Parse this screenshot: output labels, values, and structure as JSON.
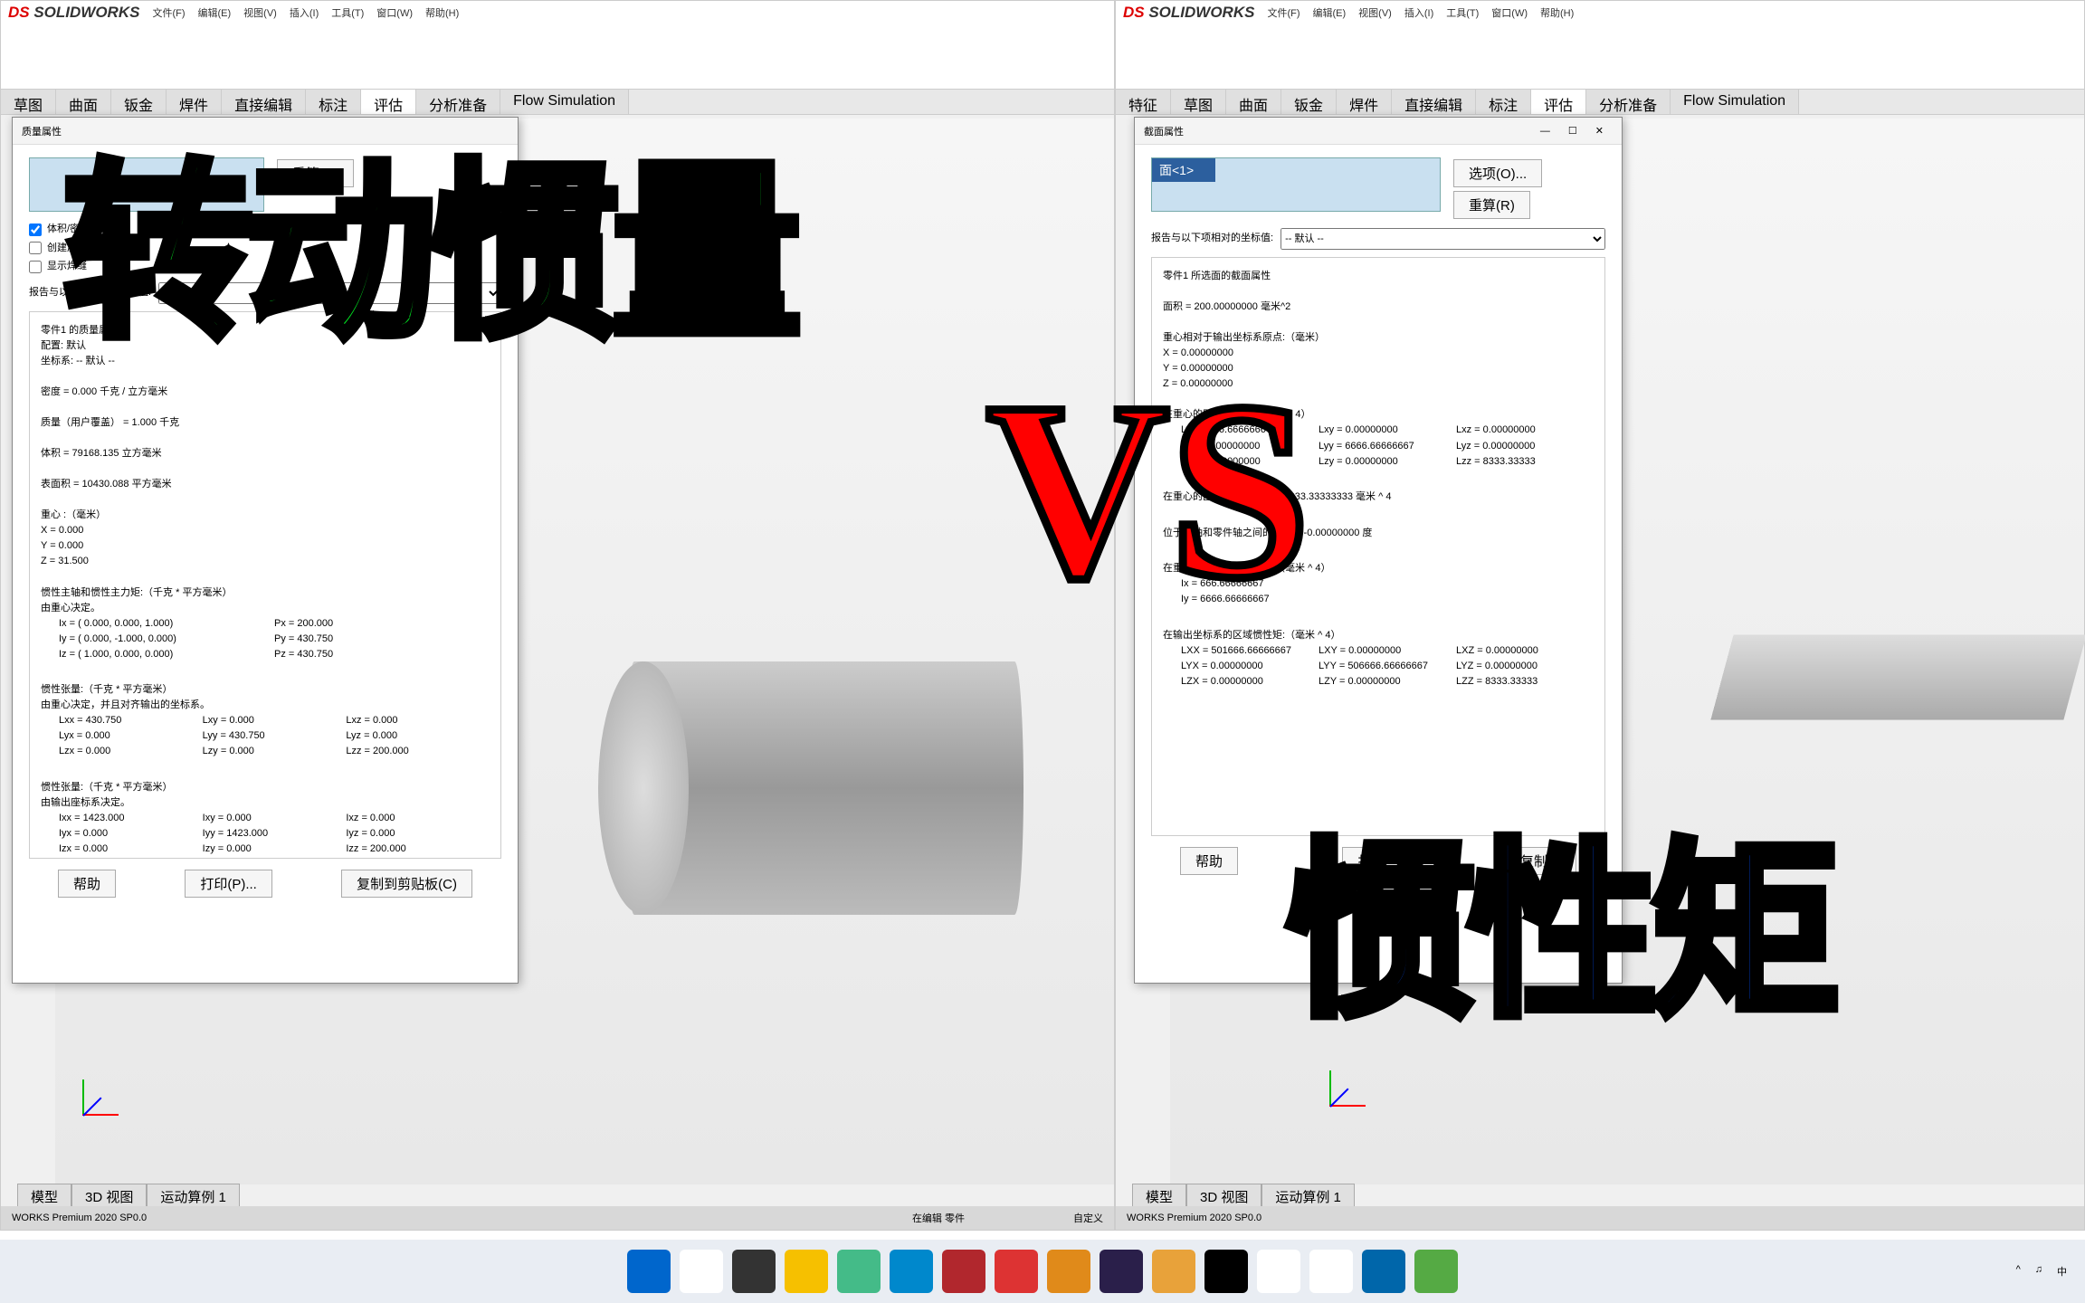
{
  "app": {
    "name": "SOLIDWORKS",
    "version": "WORKS Premium 2020 SP0.0"
  },
  "menu": [
    "文件(F)",
    "编辑(E)",
    "视图(V)",
    "插入(I)",
    "工具(T)",
    "窗口(W)",
    "帮助(H)"
  ],
  "cmdmgr_left": [
    "草图",
    "曲面",
    "钣金",
    "焊件",
    "直接编辑",
    "标注",
    "评估",
    "分析准备",
    "Flow Simulation"
  ],
  "cmdmgr_right": [
    "特征",
    "草图",
    "曲面",
    "钣金",
    "焊件",
    "直接编辑",
    "标注",
    "评估",
    "分析准备",
    "Flow Simulation"
  ],
  "cmdmgr_active": "评估",
  "dlg_left": {
    "title": "质量属性",
    "recalc": "重算(R)",
    "checks": [
      "体积/密度",
      "创建质心",
      "显示焊缝"
    ],
    "report_label": "报告与以下项相对的坐标值:",
    "report_value": "-- 默认 --",
    "lines": [
      "零件1 的质量属性",
      "   配置:  默认",
      "   坐标系:  -- 默认 --",
      "",
      "密度 = 0.000 千克 / 立方毫米",
      "",
      "质量（用户覆盖） = 1.000 千克",
      "",
      "体积 = 79168.135 立方毫米",
      "",
      "表面积 = 10430.088 平方毫米",
      "",
      "重心 :（毫米）",
      "     X = 0.000",
      "     Y = 0.000",
      "     Z = 31.500",
      "",
      "惯性主轴和惯性主力矩:（千克 * 平方毫米）",
      "由重心决定。"
    ],
    "inertia_principal": [
      [
        "Ix = ( 0.000, 0.000, 1.000)",
        "Px = 200.000"
      ],
      [
        "Iy = ( 0.000, -1.000, 0.000)",
        "Py = 430.750"
      ],
      [
        "Iz = ( 1.000, 0.000, 0.000)",
        "Pz = 430.750"
      ]
    ],
    "inertia_tensor_hdr": "惯性张量:（千克 * 平方毫米）",
    "inertia_tensor_sub": "由重心决定，并且对齐输出的坐标系。",
    "tensor1": [
      [
        "Lxx = 430.750",
        "Lxy = 0.000",
        "Lxz = 0.000"
      ],
      [
        "Lyx = 0.000",
        "Lyy = 430.750",
        "Lyz = 0.000"
      ],
      [
        "Lzx = 0.000",
        "Lzy = 0.000",
        "Lzz = 200.000"
      ]
    ],
    "inertia_tensor2_hdr": "惯性张量:（千克 * 平方毫米）",
    "inertia_tensor2_sub": "由输出座标系决定。",
    "tensor2": [
      [
        "Ixx = 1423.000",
        "Ixy = 0.000",
        "Ixz = 0.000"
      ],
      [
        "Iyx = 0.000",
        "Iyy = 1423.000",
        "Iyz = 0.000"
      ],
      [
        "Izx = 0.000",
        "Izy = 0.000",
        "Izz = 200.000"
      ]
    ],
    "buttons": [
      "帮助",
      "打印(P)...",
      "复制到剪贴板(C)"
    ]
  },
  "dlg_right": {
    "title": "截面属性",
    "item": "面<1>",
    "options": "选项(O)...",
    "recalc": "重算(R)",
    "report_label": "报告与以下项相对的坐标值:",
    "report_value": "-- 默认 --",
    "lines": [
      "零件1 所选面的截面属性",
      "",
      "面积 = 200.00000000 毫米^2",
      "",
      "重心相对于输出坐标系原点:（毫米）",
      "     X = 0.00000000",
      "     Y = 0.00000000",
      "     Z = 0.00000000",
      "",
      "在重心的区域惯性矩:（毫米 ^ 4）"
    ],
    "moments": [
      [
        "Lxx = 666.66666667",
        "Lxy = 0.00000000",
        "Lxz = 0.00000000"
      ],
      [
        "Lyx = 0.00000000",
        "Lyy = 6666.66666667",
        "Lyz = 0.00000000"
      ],
      [
        "Lzx = 0.00000000",
        "Lzy = 0.00000000",
        "Lzz = 8333.33333"
      ]
    ],
    "polar": "在重心的区域惯性极力矩 = 8333.33333333 毫米 ^ 4",
    "angle": "位于主轴和零件轴之间的角度 = -0.00000000 度",
    "second_hdr": "在重心的区域惯性二次矩:（毫米 ^ 4）",
    "second": [
      "Ix = 666.66666667",
      "Iy = 6666.66666667"
    ],
    "output_hdr": "在输出坐标系的区域惯性矩:（毫米 ^ 4）",
    "output": [
      [
        "LXX = 501666.66666667",
        "LXY = 0.00000000",
        "LXZ = 0.00000000"
      ],
      [
        "LYX = 0.00000000",
        "LYY = 506666.66666667",
        "LYZ = 0.00000000"
      ],
      [
        "LZX = 0.00000000",
        "LZY = 0.00000000",
        "LZZ = 8333.33333"
      ]
    ],
    "buttons": [
      "帮助",
      "打印",
      "复制到"
    ]
  },
  "bottom_tabs": [
    "模型",
    "3D 视图",
    "运动算例 1"
  ],
  "status": {
    "edit": "在编辑 零件",
    "custom": "自定义"
  },
  "overlay": {
    "green": "转动惯量",
    "vs": "VS",
    "blue": "惯性矩"
  },
  "taskbar_time": {
    "ime": "中"
  },
  "tray": "^ ♫ 中"
}
